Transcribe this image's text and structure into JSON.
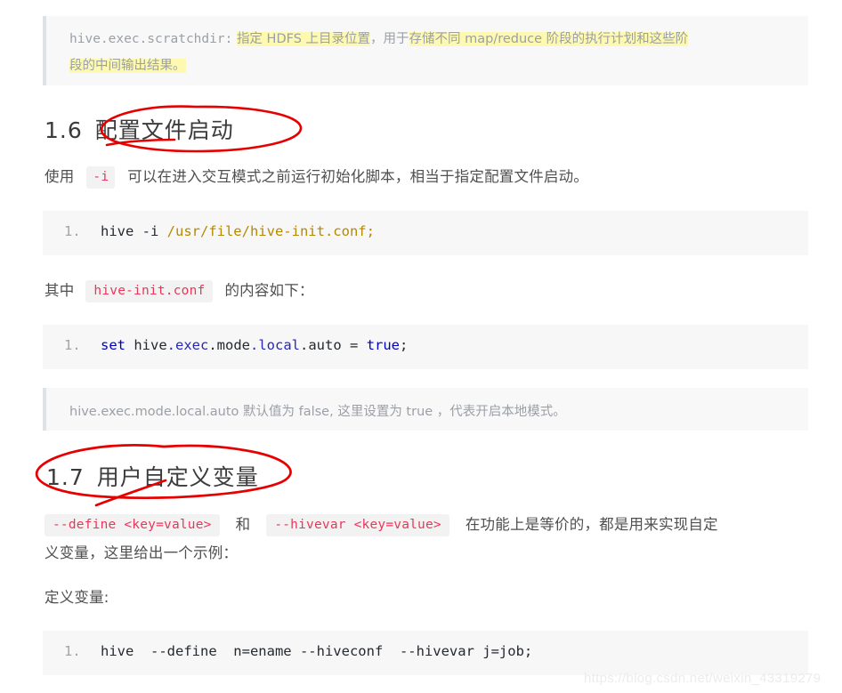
{
  "document": {
    "type": "technical-blog-article",
    "language": "zh-CN",
    "watermark": "https://blog.csdn.net/weixin_43319279"
  },
  "blockquote_scratchdir": {
    "line1_code": "hive.exec.scratchdir:",
    "line1_hl1": "指定 HDFS 上目录位置",
    "line1_mid": "，用于",
    "line1_hl2": "存储不同 map/reduce 阶段的执行计划和这些阶",
    "line2_hl": "段的中间输出结果。"
  },
  "section_1_6": {
    "number": "1.6",
    "title": "配置文件启动",
    "annotation": "red-ellipse-circling-title",
    "paragraph": {
      "before": "使用",
      "code": "-i",
      "after": "可以在进入交互模式之前运行初始化脚本，相当于指定配置文件启动。"
    },
    "code_block_1": {
      "line_number": "1.",
      "cmd": "hive -i ",
      "path": "/usr/file/hive-init.conf;"
    },
    "paragraph_2": {
      "before": "其中",
      "code": "hive-init.conf",
      "after": "的内容如下："
    },
    "code_block_2": {
      "line_number": "1.",
      "t1": "set",
      "t2": " hive",
      "t3": ".exec",
      "t4": ".mode",
      "t5": ".local",
      "t6": ".auto",
      "t7": " = ",
      "t8": "true",
      "t9": ";"
    },
    "note_blockquote": "hive.exec.mode.local.auto 默认值为 false, 这里设置为 true ，代表开启本地模式。"
  },
  "section_1_7": {
    "number": "1.7",
    "title": "用户自定义变量",
    "annotation": "red-ellipse-circling-heading",
    "paragraph": {
      "code1": "--define <key=value>",
      "mid": "和",
      "code2": "--hivevar <key=value>",
      "after_line1": "在功能上是等价的，都是用来实现自定",
      "after_line2": "义变量，这里给出一个示例："
    },
    "label_define_var": "定义变量:",
    "code_block_3": {
      "line_number": "1.",
      "command": "hive  --define  n=ename --hiveconf  --hivevar j=job;"
    }
  },
  "colors": {
    "blockquote_bg": "#f8f8f8",
    "blockquote_border": "#dfe2e5",
    "code_bg": "#f7f7f8",
    "highlight_yellow": "#fdf9b0",
    "inline_code_text": "#e8375a",
    "annotation_red": "#e60000",
    "path_token": "#b58900",
    "keyword_token": "#0000c0",
    "line_number": "#a5a5a5",
    "body_text": "#4f4f4f",
    "heading_text": "#3b3b3b",
    "watermark": "#ececec"
  }
}
